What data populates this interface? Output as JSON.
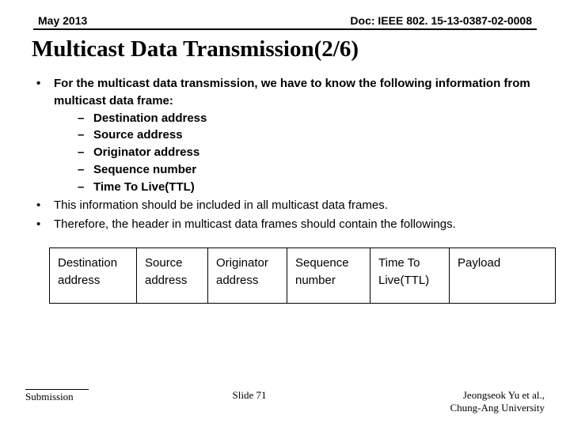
{
  "header": {
    "date": "May 2013",
    "docnum": "Doc: IEEE 802. 15-13-0387-02-0008"
  },
  "title": "Multicast Data Transmission(2/6)",
  "bullets": {
    "b1": "For the multicast data transmission, we have to know the following information from multicast data frame:",
    "subs": {
      "s1": "Destination address",
      "s2": "Source address",
      "s3": "Originator address",
      "s4": "Sequence number",
      "s5": "Time To Live(TTL)"
    },
    "b2": "This information should be included in all multicast data frames.",
    "b3": "Therefore, the header in multicast data frames should contain the followings."
  },
  "frame": {
    "c1": "Destination address",
    "c2": "Source address",
    "c3": "Originator address",
    "c4": "Sequence number",
    "c5": "Time To Live(TTL)",
    "c6": "Payload"
  },
  "footer": {
    "left": "Submission",
    "mid": "Slide 71",
    "right_line1": "Jeongseok Yu et al.,",
    "right_line2": "Chung-Ang University"
  }
}
